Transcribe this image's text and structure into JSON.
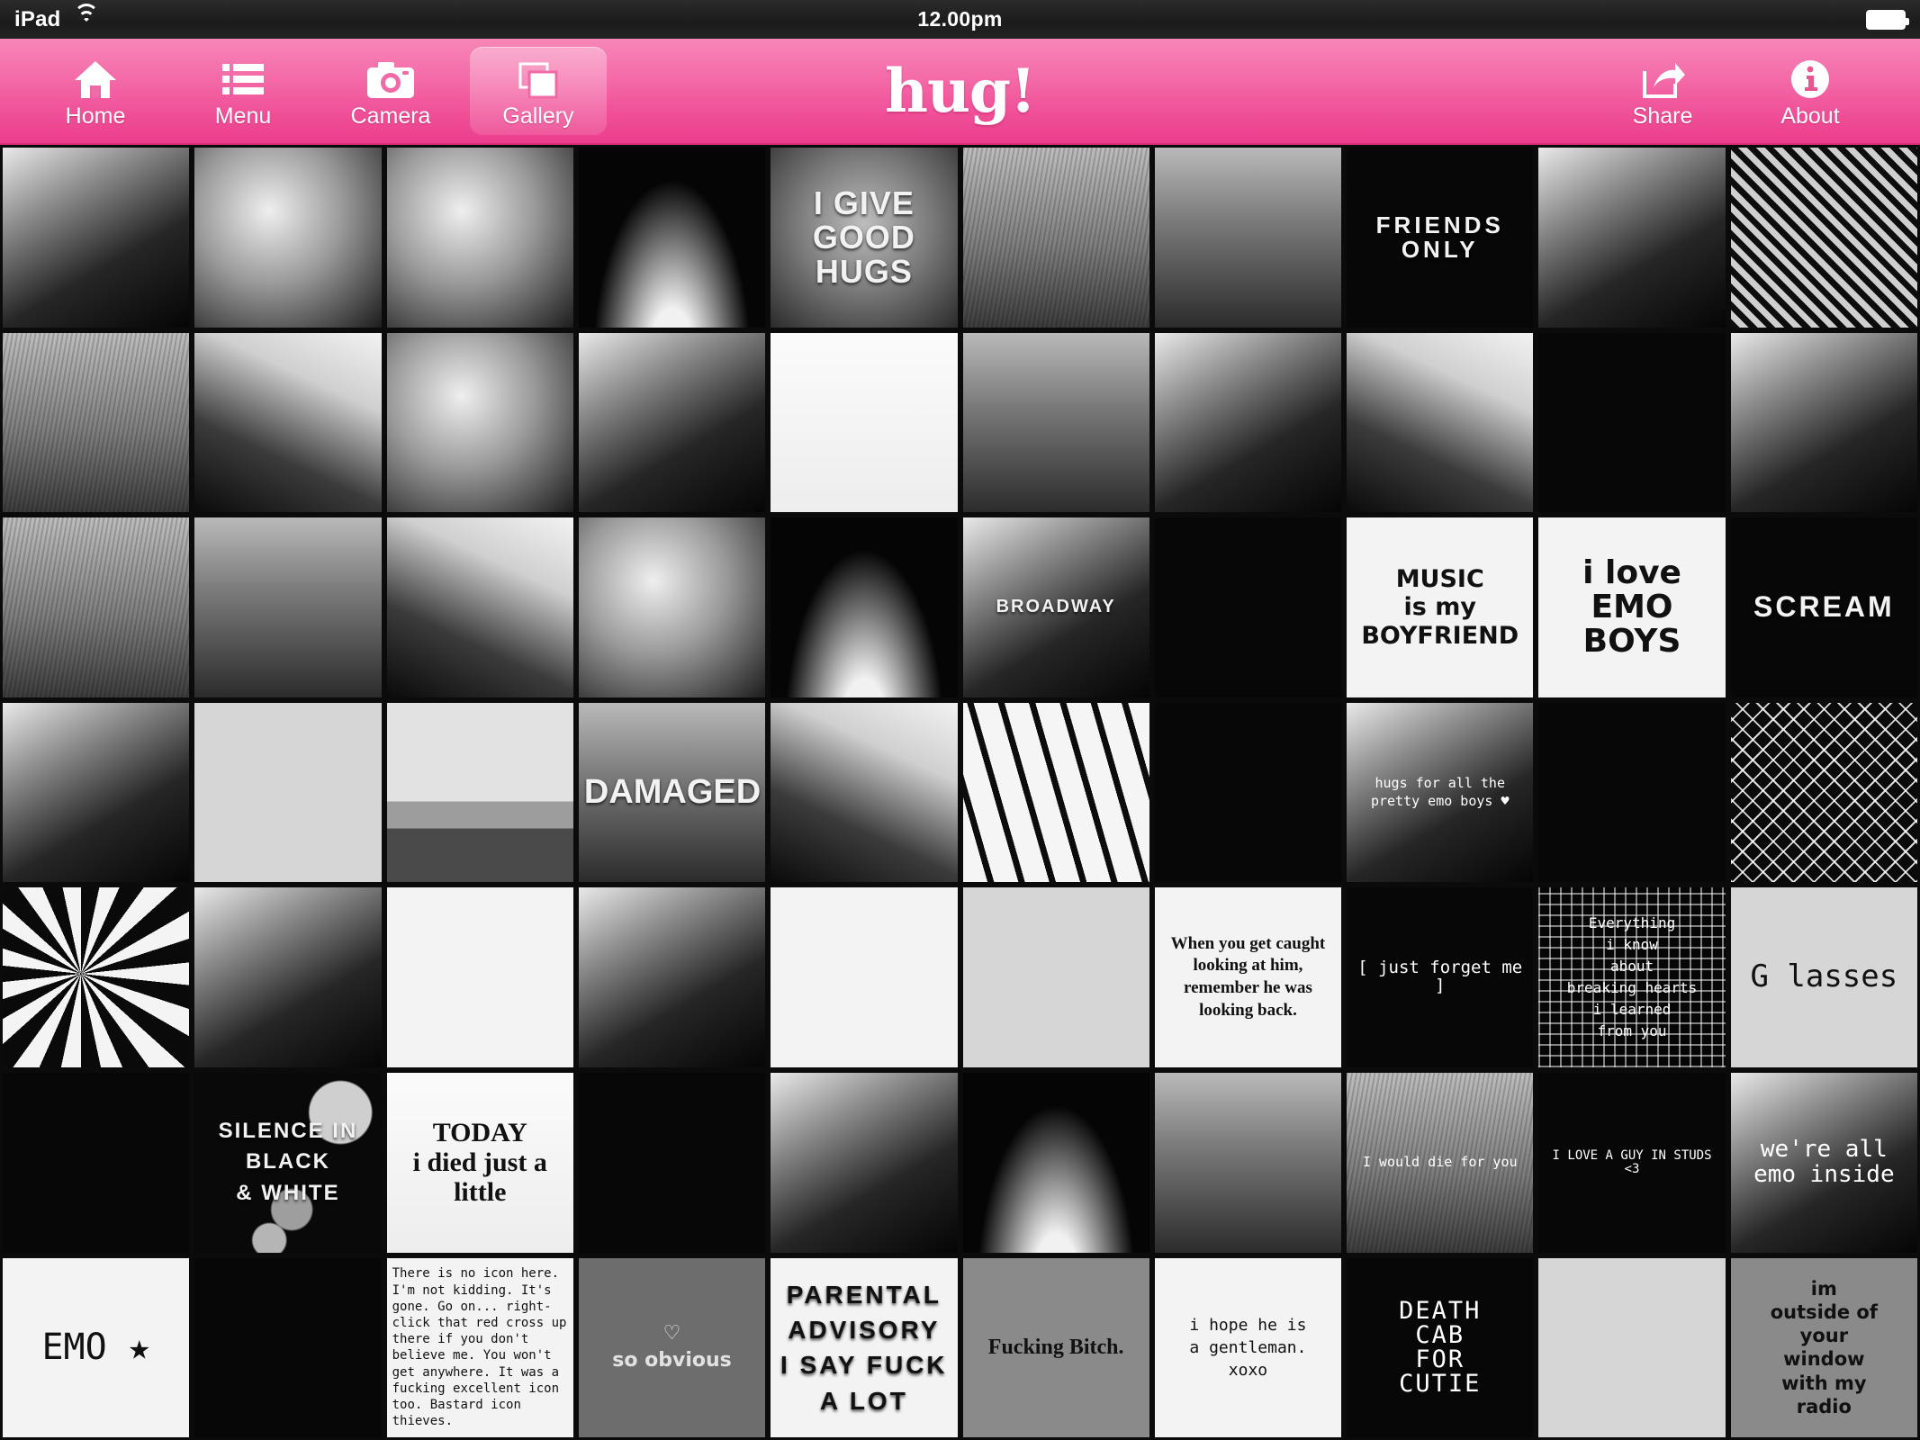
{
  "status_bar": {
    "carrier": "iPad",
    "wifi_icon": "wifi-icon",
    "time": "12.00pm",
    "battery_icon": "battery-full-icon"
  },
  "toolbar": {
    "logo": "hug!",
    "left_items": [
      {
        "id": "home",
        "label": "Home",
        "icon": "home-icon",
        "active": false
      },
      {
        "id": "menu",
        "label": "Menu",
        "icon": "list-icon",
        "active": false
      },
      {
        "id": "camera",
        "label": "Camera",
        "icon": "camera-icon",
        "active": false
      },
      {
        "id": "gallery",
        "label": "Gallery",
        "icon": "photos-icon",
        "active": true
      }
    ],
    "right_items": [
      {
        "id": "share",
        "label": "Share",
        "icon": "share-icon",
        "active": false
      },
      {
        "id": "about",
        "label": "About",
        "icon": "info-icon",
        "active": false
      }
    ],
    "accent_color": "#ef4d96",
    "accent_light": "#f786b8"
  },
  "gallery": {
    "columns": 10,
    "rows": 7,
    "tiles": [
      {
        "name": "boots-legs",
        "caption": "",
        "style": "noir"
      },
      {
        "name": "tutu-skirt",
        "caption": "",
        "style": "soft"
      },
      {
        "name": "angel-wings",
        "caption": "",
        "style": "soft"
      },
      {
        "name": "tree-swing-silhouette",
        "caption": "",
        "style": "silh"
      },
      {
        "name": "i-give-good-hugs",
        "caption": "I GIVE\nGOOD\nHUGS",
        "style": "vign"
      },
      {
        "name": "safety-pins",
        "caption": "",
        "style": "grain"
      },
      {
        "name": "window-flowers",
        "caption": "",
        "style": "shade"
      },
      {
        "name": "friends-only-sign",
        "caption": "FRIENDS ONLY",
        "style": "bk"
      },
      {
        "name": "couple-dark-room",
        "caption": "",
        "style": "noir"
      },
      {
        "name": "checkered-shoes",
        "caption": "",
        "style": "stripeD"
      },
      {
        "name": "girl-tulle-heart",
        "caption": "",
        "style": "grain"
      },
      {
        "name": "skull-handbag",
        "caption": "",
        "style": "noir2"
      },
      {
        "name": "bow-in-jar",
        "caption": "",
        "style": "soft"
      },
      {
        "name": "girl-with-camera",
        "caption": "",
        "style": "noir"
      },
      {
        "name": "spiral-notebook",
        "caption": "",
        "style": "paper"
      },
      {
        "name": "window-curtain",
        "caption": "",
        "style": "shade"
      },
      {
        "name": "portrait-she-laughs",
        "caption": "",
        "style": "noir"
      },
      {
        "name": "two-girls-kissing",
        "caption": "",
        "style": "noir2"
      },
      {
        "name": "legs-tights",
        "caption": "",
        "style": "bk"
      },
      {
        "name": "emo-boy-portrait",
        "caption": "",
        "style": "noir"
      },
      {
        "name": "converse-in-grass",
        "caption": "",
        "style": "grain"
      },
      {
        "name": "striped-socks-crowd",
        "caption": "",
        "style": "shade"
      },
      {
        "name": "sneakers-closeup",
        "caption": "",
        "style": "noir2"
      },
      {
        "name": "polka-dot-legs",
        "caption": "",
        "style": "soft"
      },
      {
        "name": "hands-making-heart",
        "caption": "",
        "style": "silh"
      },
      {
        "name": "broadway-street-sign",
        "caption": "BROADWAY",
        "style": "noir"
      },
      {
        "name": "passion-flower",
        "caption": "",
        "style": "bk"
      },
      {
        "name": "music-is-my-boyfriend",
        "caption": "MUSIC\nis my\nBOYFRIEND",
        "style": "wh"
      },
      {
        "name": "i-love-emo-boys",
        "caption": "i love\nEMO\nBOYS",
        "style": "wh"
      },
      {
        "name": "scream-poster",
        "caption": "SCREAM",
        "style": "bk"
      },
      {
        "name": "guitar-and-amps",
        "caption": "",
        "style": "noir"
      },
      {
        "name": "vintage-camera",
        "caption": "",
        "style": "lg"
      },
      {
        "name": "empty-road",
        "caption": "",
        "style": "sky"
      },
      {
        "name": "damaged-sign",
        "caption": "DAMAGED",
        "style": "shade"
      },
      {
        "name": "corset-back",
        "caption": "",
        "style": "noir2"
      },
      {
        "name": "piano-keys",
        "caption": "",
        "style": "keys"
      },
      {
        "name": "butterflies-dark",
        "caption": "",
        "style": "bk"
      },
      {
        "name": "hugs-for-pretty-emo-boys",
        "caption": "hugs for all the\npretty emo boys ♥",
        "style": "noir"
      },
      {
        "name": "converse-fishnet",
        "caption": "",
        "style": "bk"
      },
      {
        "name": "fishnet-texture",
        "caption": "",
        "style": "mesh"
      },
      {
        "name": "starburst-pattern",
        "caption": "",
        "style": "burst"
      },
      {
        "name": "bass-guitarist",
        "caption": "",
        "style": "noir"
      },
      {
        "name": "boy-splatter",
        "caption": "",
        "style": "wh"
      },
      {
        "name": "girl-big-eyes",
        "caption": "",
        "style": "noir"
      },
      {
        "name": "doodle-hearts",
        "caption": "",
        "style": "wh"
      },
      {
        "name": "toddler-portrait",
        "caption": "",
        "style": "lg"
      },
      {
        "name": "caught-looking-quote",
        "caption": "When you get caught\nlooking at him,\nremember he was\nlooking back.",
        "style": "wh"
      },
      {
        "name": "just-forget-me",
        "caption": "[ just forget me ]",
        "style": "bk"
      },
      {
        "name": "breaking-hearts-collage",
        "caption": "Everything\ni know\nabout\nbreaking hearts\ni learned\nfrom you",
        "style": "dotgrid"
      },
      {
        "name": "glasses-photo",
        "caption": "G lasses",
        "style": "lg"
      },
      {
        "name": "crow-silhouette",
        "caption": "",
        "style": "bk"
      },
      {
        "name": "silence-in-black-and-white",
        "caption": "SILENCE IN\nBLACK\n& WHITE",
        "style": "bokeh"
      },
      {
        "name": "today-i-died-just-a-little",
        "caption": "TODAY\ni died just a little",
        "style": "paper"
      },
      {
        "name": "dark-rose",
        "caption": "",
        "style": "bk"
      },
      {
        "name": "studded-dress",
        "caption": "",
        "style": "noir"
      },
      {
        "name": "candle-flame",
        "caption": "",
        "style": "silh"
      },
      {
        "name": "umbrella-girl",
        "caption": "",
        "style": "shade"
      },
      {
        "name": "i-would-die-for-you",
        "caption": "I would die for you",
        "style": "grain"
      },
      {
        "name": "i-love-a-guy-in-studs",
        "caption": "I LOVE A GUY IN STUDS <3",
        "style": "bk"
      },
      {
        "name": "were-all-emo-inside",
        "caption": "we're all\nemo inside",
        "style": "noir"
      },
      {
        "name": "emo-star-badge",
        "caption": "EMO ★",
        "style": "wh"
      },
      {
        "name": "hands-in-dark",
        "caption": "",
        "style": "bk"
      },
      {
        "name": "no-icon-here-note",
        "caption": "There is no icon here.  I'm not kidding.  It's gone. Go on... right-click that red cross up there if you don't believe me.  You won't get anywhere. It was a fucking excellent icon too. Bastard icon thieves.",
        "style": "wh"
      },
      {
        "name": "so-obvious-wall",
        "caption": "♡\nso obvious",
        "style": "gy2"
      },
      {
        "name": "parental-advisory",
        "caption": "PARENTAL\nADVISORY\nI SAY FUCK A LOT",
        "style": "wh"
      },
      {
        "name": "fucking-bitch-text",
        "caption": "Fucking Bitch.",
        "style": "gy"
      },
      {
        "name": "hope-he-is-a-gentleman",
        "caption": "i hope he is\na gentleman.\nxoxo",
        "style": "wh"
      },
      {
        "name": "death-cab-for-cutie",
        "caption": "DEATH\nCAB\nFOR\nCUTIE",
        "style": "bk"
      },
      {
        "name": "headphones",
        "caption": "",
        "style": "lg"
      },
      {
        "name": "outside-your-window-radio",
        "caption": "im\noutside of\nyour\nwindow\nwith my\nradio",
        "style": "gy"
      }
    ]
  }
}
